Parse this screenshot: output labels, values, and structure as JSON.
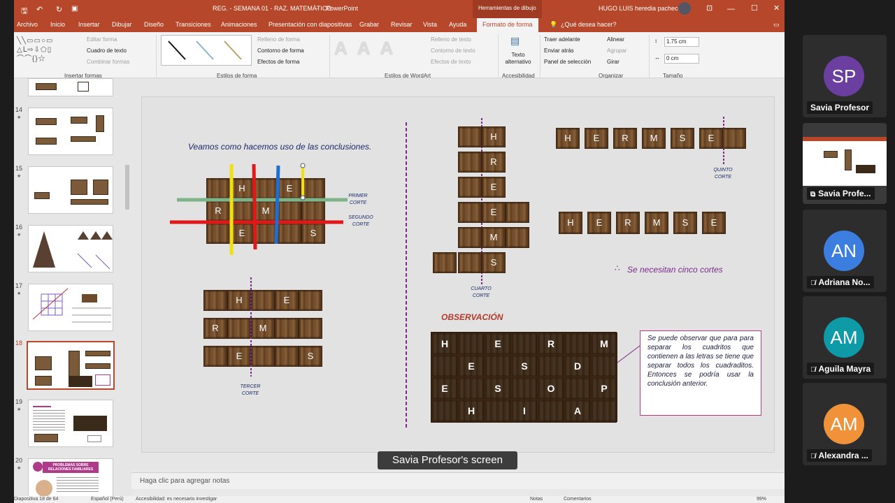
{
  "app": {
    "doc_title": "REG. - SEMANA 01 - RAZ. MATEMÁTICO",
    "app_name": "PowerPoint",
    "tool_context": "Herramientas de dibujo",
    "user": "HUGO LUIS heredia pacheco"
  },
  "tabs": [
    "Archivo",
    "Inicio",
    "Insertar",
    "Dibujar",
    "Diseño",
    "Transiciones",
    "Animaciones",
    "Presentación con diapositivas",
    "Grabar",
    "Revisar",
    "Vista",
    "Ayuda",
    "Formato de forma"
  ],
  "tell_me": "¿Qué desea hacer?",
  "ribbon": {
    "insert_shapes": {
      "edit_shape": "Editar forma",
      "text_box": "Cuadro de texto",
      "merge": "Combinar formas",
      "label": "Insertar formas"
    },
    "shape_styles": {
      "fill": "Relleno de forma",
      "outline": "Contorno de forma",
      "effects": "Efectos de forma",
      "label": "Estilos de forma"
    },
    "wordart": {
      "text_fill": "Relleno de texto",
      "text_outline": "Contorno de texto",
      "text_effects": "Efectos de texto",
      "label": "Estilos de WordArt"
    },
    "accessibility": {
      "alt_text": "Texto alternativo",
      "label": "Accesibilidad"
    },
    "arrange": {
      "bring_forward": "Traer adelante",
      "send_backward": "Enviar atrás",
      "selection_pane": "Panel de selección",
      "align": "Alinear",
      "group": "Agrupar",
      "rotate": "Girar",
      "label": "Organizar"
    },
    "size": {
      "height": "1.75 cm",
      "width": "0 cm",
      "label": "Tamaño"
    }
  },
  "thumbnails": [
    "14",
    "15",
    "16",
    "17",
    "18",
    "19",
    "20"
  ],
  "thumb20_title": "PROBLEMAS SOBRE RELACIONES FAMILIARES",
  "slide": {
    "intro": "Veamos como hacemos uso de las conclusiones.",
    "grid1_rows": [
      [
        "",
        "H",
        "",
        "E",
        ""
      ],
      [
        "R",
        "",
        "M",
        "",
        ""
      ],
      [
        "",
        "E",
        "",
        "",
        "S"
      ]
    ],
    "grid2_rows": [
      [
        "",
        "H",
        "",
        "E",
        ""
      ],
      [
        "R",
        "",
        "M",
        "",
        ""
      ],
      [
        "",
        "E",
        "",
        "",
        "S"
      ]
    ],
    "cut1": "PRIMER\nCORTE",
    "cut2": "SEGUNDO\nCORTE",
    "cut3": "TERCER\nCORTE",
    "cut4": "CUARTO\nCORTE",
    "cut5": "QUINTO\nCORTE",
    "column_letters": [
      "H",
      "R",
      "E",
      "E",
      "M",
      "S"
    ],
    "row_top": [
      "H",
      "E",
      "R",
      "M",
      "S",
      "E"
    ],
    "row_bottom": [
      "H",
      "E",
      "R",
      "M",
      "S",
      "E"
    ],
    "therefore": "∴",
    "conclusion": "Se necesitan cinco cortes",
    "observation_title": "OBSERVACIÓN",
    "obs_grid": [
      [
        "H",
        "",
        "E",
        "",
        "R",
        "",
        "M"
      ],
      [
        "",
        "E",
        "",
        "S",
        "",
        "D",
        ""
      ],
      [
        "E",
        "",
        "S",
        "",
        "O",
        "",
        "P"
      ],
      [
        "",
        "H",
        "",
        "I",
        "",
        "A",
        ""
      ]
    ],
    "obs_text": "Se puede observar que para para separar los cuadritos que contienen a las letras se tiene que separar todos los cuadraditos. Entonces se podría usar la conclusión anterior."
  },
  "notes_placeholder": "Haga clic para agregar notas",
  "status": {
    "slide": "Diapositiva 18 de 64",
    "lang": "Español (Perú)",
    "access": "Accesibilidad: es necesario investigar",
    "notes": "Notas",
    "comments": "Comentarios",
    "zoom": "99%"
  },
  "screen_banner": "Savia Profesor's screen",
  "participants": [
    {
      "initials": "SP",
      "name": "Savia Profesor",
      "color": "#6b3fa0"
    },
    {
      "initials": "",
      "name": "Savia Profe...",
      "color": "#2d2d2d"
    },
    {
      "initials": "AN",
      "name": "Adriana No...",
      "color": "#3c7ee0"
    },
    {
      "initials": "AM",
      "name": "Aguila Mayra",
      "color": "#0e9aa7"
    },
    {
      "initials": "AM",
      "name": "Alexandra ...",
      "color": "#f0923a"
    }
  ]
}
